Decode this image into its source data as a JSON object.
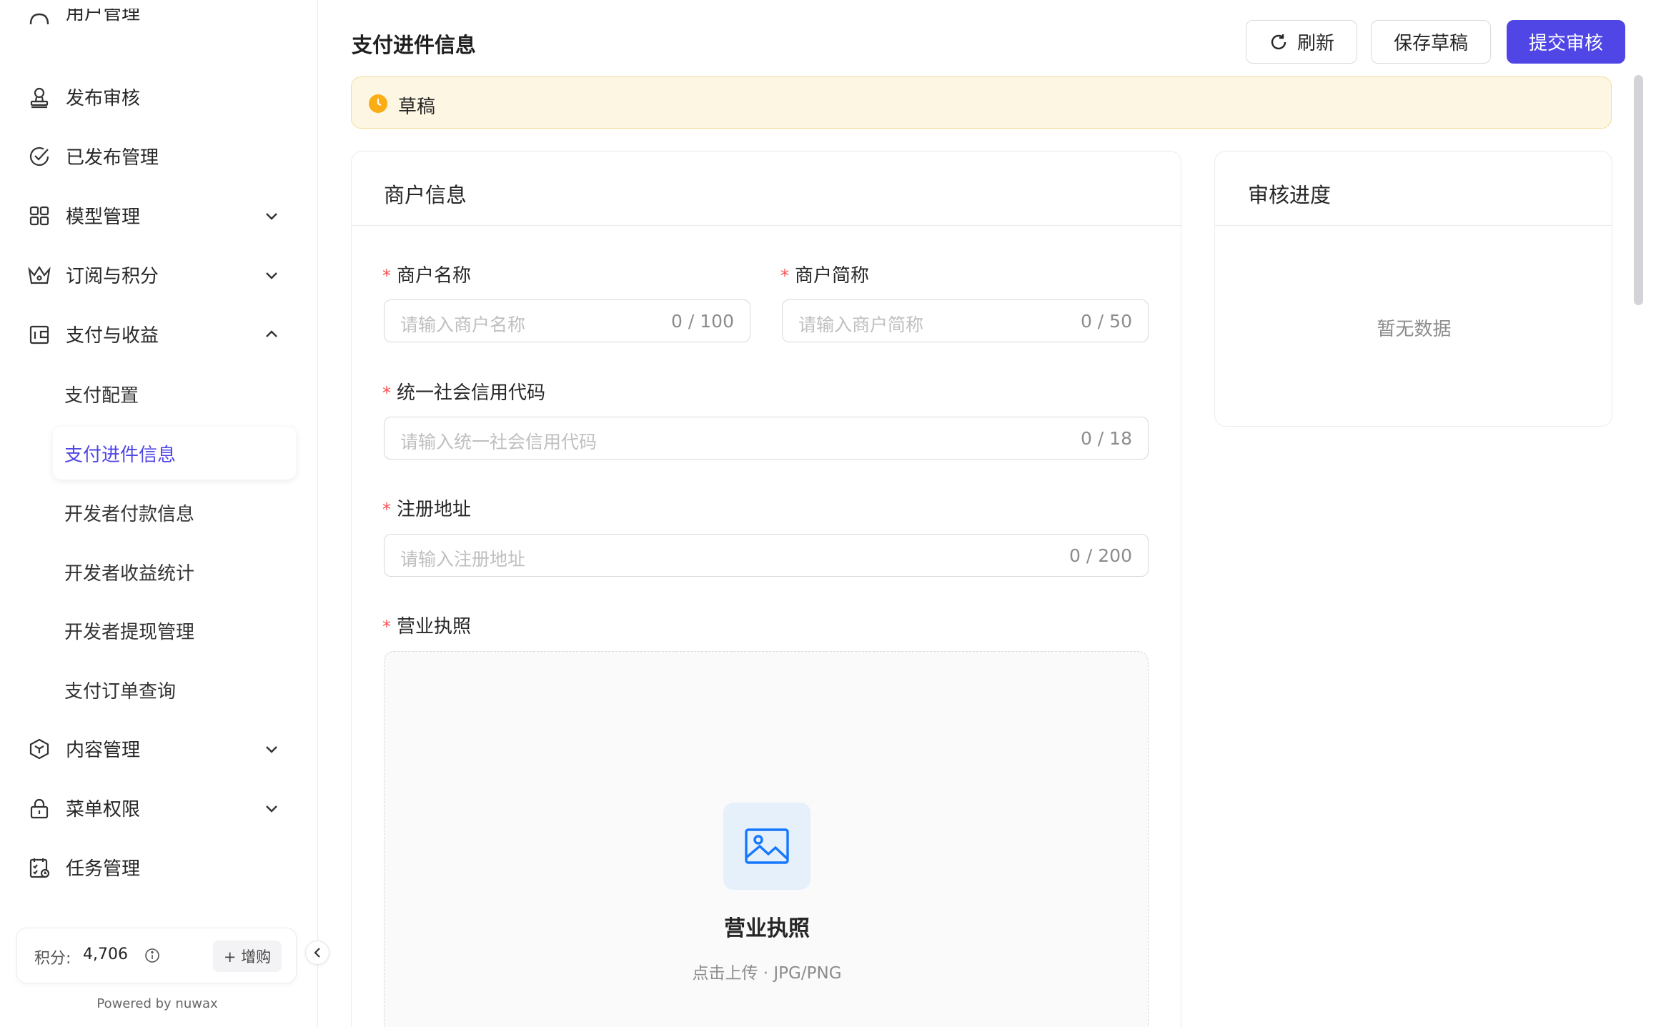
{
  "sidebar": {
    "partial_item_label": "用户管理",
    "items": [
      {
        "label": "发布审核",
        "icon": "user-stamp-icon"
      },
      {
        "label": "已发布管理",
        "icon": "check-circle-icon"
      },
      {
        "label": "模型管理",
        "icon": "grid-icon"
      },
      {
        "label": "订阅与积分",
        "icon": "crown-icon"
      },
      {
        "label": "支付与收益",
        "icon": "wallet-icon"
      },
      {
        "label": "内容管理",
        "icon": "cube-icon"
      },
      {
        "label": "菜单权限",
        "icon": "lock-icon"
      },
      {
        "label": "任务管理",
        "icon": "task-icon"
      }
    ],
    "sub_items": [
      {
        "label": "支付配置"
      },
      {
        "label": "支付进件信息"
      },
      {
        "label": "开发者付款信息"
      },
      {
        "label": "开发者收益统计"
      },
      {
        "label": "开发者提现管理"
      },
      {
        "label": "支付订单查询"
      }
    ],
    "points_label": "积分:",
    "points_value": "4,706",
    "buy_label": "+ 增购",
    "powered_by": "Powered by nuwax",
    "accent_color": "#4f46e5"
  },
  "header": {
    "title": "支付进件信息",
    "refresh_label": "刷新",
    "save_draft_label": "保存草稿",
    "submit_label": "提交审核"
  },
  "status": {
    "text": "草稿",
    "color": "#faad14"
  },
  "merchant": {
    "title": "商户信息",
    "fields": {
      "name": {
        "label": "商户名称",
        "placeholder": "请输入商户名称",
        "count": "0 / 100"
      },
      "short_name": {
        "label": "商户简称",
        "placeholder": "请输入商户简称",
        "count": "0 / 50"
      },
      "credit_code": {
        "label": "统一社会信用代码",
        "placeholder": "请输入统一社会信用代码",
        "count": "0 / 18"
      },
      "address": {
        "label": "注册地址",
        "placeholder": "请输入注册地址",
        "count": "0 / 200"
      },
      "license": {
        "label": "营业执照",
        "upload_title": "营业执照",
        "upload_hint": "点击上传 · JPG/PNG"
      }
    },
    "required_mark": "*"
  },
  "review": {
    "title": "审核进度",
    "empty_text": "暂无数据"
  }
}
